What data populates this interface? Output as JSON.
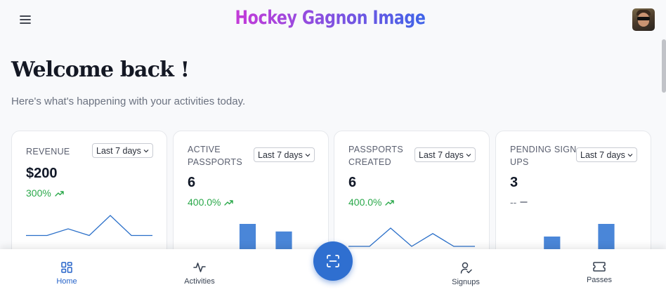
{
  "header": {
    "menu_icon": "hamburger-menu-icon",
    "brand": "Hockey Gagnon Image",
    "avatar": "user-avatar"
  },
  "welcome": {
    "title": "Welcome back !",
    "subtitle": "Here's what's happening with your activities today."
  },
  "cards": [
    {
      "label": "REVENUE",
      "period": "Last 7 days",
      "value": "$200",
      "change": "300%",
      "trend": "up",
      "chart": {
        "type": "line",
        "values": [
          1,
          1,
          2,
          1,
          4,
          1,
          1
        ]
      }
    },
    {
      "label": "ACTIVE PASSPORTS",
      "period": "Last 7 days",
      "value": "6",
      "change": "400.0%",
      "trend": "up",
      "chart": {
        "type": "bar",
        "values": [
          0,
          0,
          0,
          1,
          0,
          0.7,
          0
        ]
      }
    },
    {
      "label": "PASSPORTS CREATED",
      "period": "Last 7 days",
      "value": "6",
      "change": "400.0%",
      "trend": "up",
      "chart": {
        "type": "line",
        "values": [
          0,
          0,
          1,
          0,
          0.7,
          0,
          0
        ]
      }
    },
    {
      "label": "PENDING SIGN UPS",
      "period": "Last 7 days",
      "value": "3",
      "change": "--",
      "trend": "flat",
      "chart": {
        "type": "bar",
        "values": [
          0,
          0,
          0.5,
          0,
          0,
          1,
          0
        ]
      }
    }
  ],
  "colors": {
    "accent": "#2f6fd0",
    "positive": "#2aa84a",
    "chart": "#4a86d8"
  },
  "nav": {
    "items": [
      {
        "label": "Home",
        "icon": "home-grid-icon",
        "active": true
      },
      {
        "label": "Activities",
        "icon": "activity-pulse-icon",
        "active": false
      },
      {
        "label": "Signups",
        "icon": "user-check-icon",
        "active": false
      },
      {
        "label": "Passes",
        "icon": "ticket-icon",
        "active": false
      }
    ],
    "scan_icon": "scan-icon"
  }
}
